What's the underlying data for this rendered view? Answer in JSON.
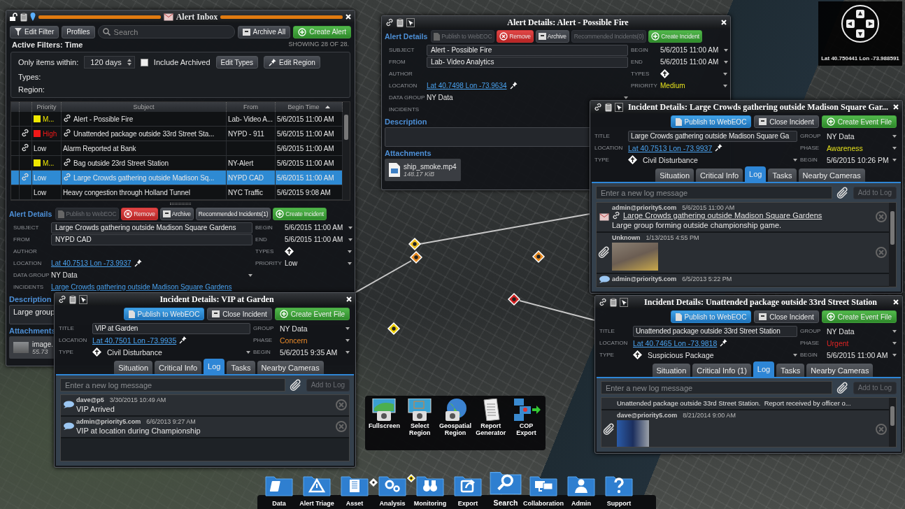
{
  "map": {
    "coordinates": "Lat 40.750441 Lon -73.988591"
  },
  "inbox": {
    "title": "Alert Inbox",
    "toolbar": {
      "edit_filter": "Edit Filter",
      "profiles": "Profiles",
      "search_placeholder": "Search",
      "archive_all": "Archive All",
      "create_alert": "Create Alert"
    },
    "active_filters": "Active Filters: Time",
    "showing": "SHOWING 28 OF 28.",
    "filter": {
      "within_label": "Only items within:",
      "within_value": "120 days",
      "include_archived": {
        "label": "Include Archived",
        "checked": false
      },
      "edit_types": "Edit Types",
      "edit_region": "Edit Region",
      "types_label": "Types:",
      "region_label": "Region:"
    },
    "table": {
      "columns": [
        "Priority",
        "Subject",
        "From",
        "Begin Time"
      ],
      "rows": [
        {
          "attached": false,
          "color": "#f0e800",
          "priority": "M...",
          "linked": true,
          "subject": "Alert - Possible Fire",
          "from": "Lab- Video A...",
          "begin": "5/6/2015 11:00 AM",
          "selected": false
        },
        {
          "attached": true,
          "color": "#f01818",
          "priority": "High",
          "linked": true,
          "subject": "Unattended package outside 33rd Street Sta...",
          "from": "NYPD - 911",
          "begin": "5/6/2015 11:00 AM",
          "selected": false
        },
        {
          "attached": true,
          "priority": "Low",
          "linked": false,
          "subject": "Alarm Reported at Bank",
          "begin": "5/6/2015 11:00 AM",
          "selected": false
        },
        {
          "attached": false,
          "color": "#f0e800",
          "priority": "M...",
          "linked": true,
          "subject": "Bag outside 23rd Street Station",
          "from": "NY-Alert",
          "begin": "5/6/2015 11:00 AM",
          "selected": false
        },
        {
          "attached": true,
          "priority": "Low",
          "linked": true,
          "subject": "Large Crowds gathering outside Madison Sq...",
          "from": "NYPD CAD",
          "begin": "5/6/2015 11:00 AM",
          "selected": true
        },
        {
          "attached": false,
          "priority": "Low",
          "linked": false,
          "subject": "Heavy congestion through Holland Tunnel",
          "from": "NYC Traffic",
          "begin": "5/6/2015 9:08 AM",
          "selected": false
        }
      ]
    },
    "details": {
      "heading": "Alert Details",
      "buttons": [
        {
          "kind": "publish",
          "label": "Publish to WebEOC",
          "disabled": true
        },
        {
          "kind": "remove",
          "label": "Remove",
          "disabled": false
        },
        {
          "kind": "archive",
          "label": "Archive",
          "disabled": false
        },
        {
          "kind": "plain",
          "label": "Recommended Incidents(1)",
          "disabled": false
        },
        {
          "kind": "create",
          "label": "Create Incident",
          "disabled": false
        }
      ],
      "left_fields": [
        {
          "label": "SUBJECT",
          "kind": "input",
          "value": "Large Crowds gathering outside Madison Square Gardens"
        },
        {
          "label": "FROM",
          "kind": "input",
          "value": "NYPD CAD"
        },
        {
          "label": "AUTHOR",
          "kind": "text"
        },
        {
          "label": "LOCATION",
          "kind": "location",
          "value": "Lat 40.7513 Lon -73.9937"
        },
        {
          "label": "DATA GROUP",
          "kind": "select",
          "value": "NY Data"
        },
        {
          "label": "INCIDENTS",
          "kind": "link",
          "value": "Large Crowds gathering outside Madison Square Gardens"
        }
      ],
      "right_fields": [
        {
          "label": "BEGIN",
          "kind": "select",
          "value": "5/6/2015 11:00 AM"
        },
        {
          "label": "END",
          "kind": "select",
          "value": "5/6/2015 11:00 AM"
        },
        {
          "label": "TYPES",
          "kind": "icon"
        },
        {
          "label": "PRIORITY",
          "kind": "select",
          "value": "Low"
        }
      ],
      "description": {
        "label": "Description",
        "text": "Large group"
      },
      "attachments": {
        "label": "Attachments",
        "items": [
          {
            "kind": "photo",
            "name": "image.",
            "size": "55.73"
          }
        ]
      }
    }
  },
  "fire_alert": {
    "title": "Alert Details: Alert - Possible Fire",
    "details": {
      "heading": "Alert Details",
      "buttons": [
        {
          "kind": "publish",
          "label": "Publish to WebEOC",
          "disabled": true
        },
        {
          "kind": "remove",
          "label": "Remove",
          "disabled": false
        },
        {
          "kind": "archive",
          "label": "Archive",
          "disabled": false
        },
        {
          "kind": "plain",
          "label": "Recommended Incidents(0)",
          "disabled": true
        },
        {
          "kind": "create",
          "label": "Create Incident",
          "disabled": false
        }
      ],
      "left_fields": [
        {
          "label": "SUBJECT",
          "kind": "input",
          "value": "Alert - Possible Fire"
        },
        {
          "label": "FROM",
          "kind": "input",
          "value": "Lab- Video Analytics"
        },
        {
          "label": "AUTHOR",
          "kind": "text"
        },
        {
          "label": "LOCATION",
          "kind": "location",
          "value": "Lat 40.7498 Lon -73.9634"
        },
        {
          "label": "DATA GROUP",
          "kind": "select",
          "value": "NY Data"
        },
        {
          "label": "INCIDENTS",
          "kind": "text"
        }
      ],
      "right_fields": [
        {
          "label": "BEGIN",
          "kind": "select",
          "value": "5/6/2015 11:00 AM"
        },
        {
          "label": "END",
          "kind": "select",
          "value": "5/6/2015 11:00 AM"
        },
        {
          "label": "TYPES",
          "kind": "icon"
        },
        {
          "label": "PRIORITY",
          "kind": "select",
          "value": "Medium",
          "color": "#e4e01c"
        }
      ],
      "description": {
        "label": "Description"
      },
      "attachments": {
        "label": "Attachments",
        "items": [
          {
            "kind": "file",
            "name": "ship_smoke.mp4",
            "size": "148.17 KiB"
          }
        ]
      }
    }
  },
  "incidents": [
    {
      "title": "Incident Details: Large Crowds gathering outside Madison Square Gar...",
      "buttons": [
        {
          "kind": "publish",
          "label": "Publish to WebEOC"
        },
        {
          "kind": "close",
          "label": "Close Incident"
        },
        {
          "kind": "create",
          "label": "Create Event File"
        }
      ],
      "fields": {
        "title": {
          "label": "TITLE",
          "value": "Large Crowds gathering outside Madison Square Ga"
        },
        "location": {
          "label": "LOCATION",
          "value": "Lat 40.7513 Lon -73.9937"
        },
        "type": {
          "label": "TYPE",
          "value": "Civil Disturbance"
        },
        "group": {
          "label": "GROUP",
          "value": "NY Data"
        },
        "phase": {
          "label": "PHASE",
          "value": "Awareness",
          "color": "#e4e01c"
        },
        "begin": {
          "label": "BEGIN",
          "value": "5/6/2015 10:26 PM"
        }
      },
      "tabs": [
        {
          "label": "Situation",
          "selected": false
        },
        {
          "label": "Critical Info",
          "selected": false
        },
        {
          "label": "Log",
          "selected": true
        },
        {
          "label": "Tasks",
          "selected": false
        },
        {
          "label": "Nearby Cameras",
          "selected": false
        }
      ],
      "log_placeholder": "Enter a new log message",
      "add_to_log": "Add to Log",
      "log": [
        {
          "kind": "alert",
          "author": "admin@priority5.com",
          "time": "5/6/2015 11:00 AM",
          "link": "Large Crowds gathering outside Madison Square Gardens",
          "text": "Large group forming outside championship game."
        },
        {
          "kind": "attachment",
          "author": "Unknown",
          "time": "1/13/2015 4:55 PM"
        },
        {
          "kind": "message",
          "author": "admin@priority5.com",
          "time": "6/5/2013 5:22 PM"
        }
      ]
    },
    {
      "title": "Incident Details: VIP at Garden",
      "buttons": [
        {
          "kind": "publish",
          "label": "Publish to WebEOC"
        },
        {
          "kind": "close",
          "label": "Close Incident"
        },
        {
          "kind": "create",
          "label": "Create Event File"
        }
      ],
      "fields": {
        "title": {
          "label": "TITLE",
          "value": "VIP at Garden"
        },
        "location": {
          "label": "LOCATION",
          "value": "Lat 40.7501 Lon -73.9935"
        },
        "type": {
          "label": "TYPE",
          "value": "Civil Disturbance"
        },
        "group": {
          "label": "GROUP",
          "value": "NY Data"
        },
        "phase": {
          "label": "PHASE",
          "value": "Concern",
          "color": "#e8892a"
        },
        "begin": {
          "label": "BEGIN",
          "value": "5/6/2015 9:35 AM"
        }
      },
      "tabs": [
        {
          "label": "Situation",
          "selected": false
        },
        {
          "label": "Critical Info",
          "selected": false
        },
        {
          "label": "Log",
          "selected": true
        },
        {
          "label": "Tasks",
          "selected": false
        },
        {
          "label": "Nearby Cameras",
          "selected": false
        }
      ],
      "log_placeholder": "Enter a new log message",
      "add_to_log": "Add to Log",
      "log": [
        {
          "kind": "message",
          "author": "dave@p5",
          "time": "3/30/2015 10:49 AM",
          "text": "VIP Arrived"
        },
        {
          "kind": "message",
          "author": "admin@priority5.com",
          "time": "6/6/2013 9:27 AM",
          "text": "VIP at location during Championship"
        }
      ]
    },
    {
      "title": "Incident Details: Unattended package outside 33rd Street Station",
      "buttons": [
        {
          "kind": "publish",
          "label": "Publish to WebEOC"
        },
        {
          "kind": "close",
          "label": "Close Incident"
        },
        {
          "kind": "create",
          "label": "Create Event File"
        }
      ],
      "fields": {
        "title": {
          "label": "TITLE",
          "value": "Unattended package outside 33rd Street Station"
        },
        "location": {
          "label": "LOCATION",
          "value": "Lat 40.7465 Lon -73.9818"
        },
        "type": {
          "label": "TYPE",
          "value": "Suspicious Package"
        },
        "group": {
          "label": "GROUP",
          "value": "NY Data"
        },
        "phase": {
          "label": "PHASE",
          "value": "Urgent",
          "color": "#e02424"
        },
        "begin": {
          "label": "BEGIN",
          "value": "5/6/2015 11:00 AM"
        }
      },
      "tabs": [
        {
          "label": "Situation",
          "selected": false
        },
        {
          "label": "Critical Info (1)",
          "selected": false
        },
        {
          "label": "Log",
          "selected": true
        },
        {
          "label": "Tasks",
          "selected": false
        },
        {
          "label": "Nearby Cameras",
          "selected": false
        }
      ],
      "log_placeholder": "Enter a new log message",
      "add_to_log": "Add to Log",
      "log": [
        {
          "kind": "note",
          "text": "Unattended package outside 33rd Street Station.  Report received by officer o..."
        },
        {
          "kind": "attachment",
          "author": "dave@priority5.com",
          "time": "8/21/2014 9:00 AM"
        }
      ]
    }
  ],
  "tools": [
    "Fullscreen",
    "Select Region",
    "Geospatial Region",
    "Report Generator",
    "COP Export"
  ],
  "dock": [
    {
      "label": "Data",
      "selected": false
    },
    {
      "label": "Alert Triage",
      "selected": false
    },
    {
      "label": "Asset",
      "selected": false
    },
    {
      "label": "Analysis",
      "selected": false
    },
    {
      "label": "Monitoring",
      "selected": false
    },
    {
      "label": "Export",
      "selected": false
    },
    {
      "label": "Search",
      "selected": true
    },
    {
      "label": "Collaboration",
      "selected": false
    },
    {
      "label": "Admin",
      "selected": false
    },
    {
      "label": "Support",
      "selected": false
    }
  ]
}
